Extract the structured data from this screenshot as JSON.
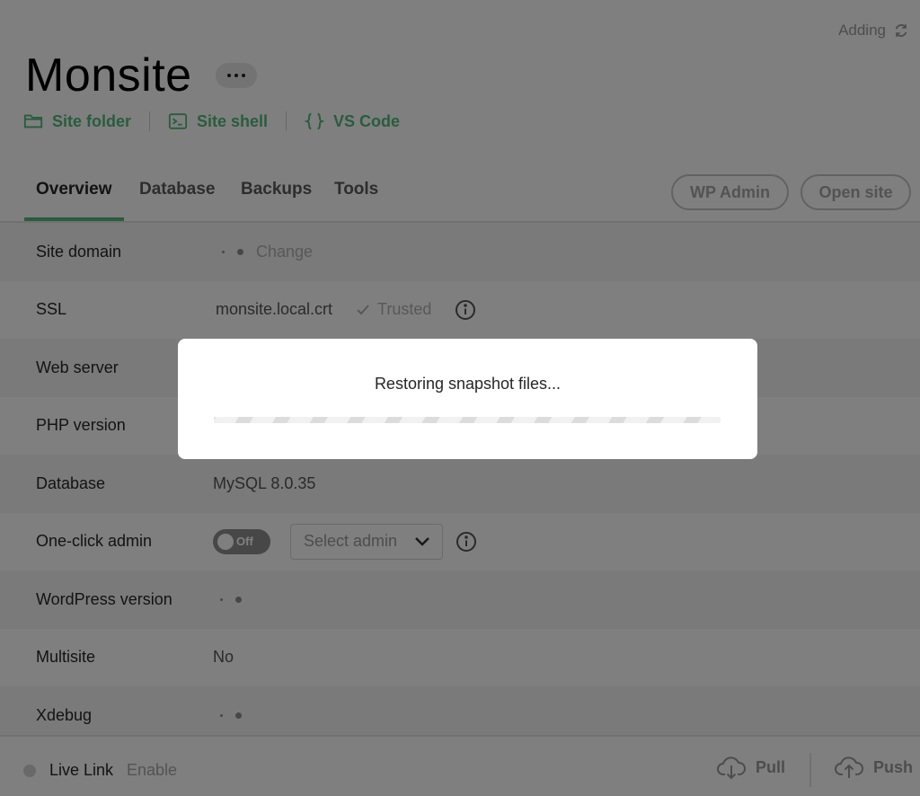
{
  "header": {
    "status": "Adding",
    "site_name": "Monsite",
    "quick_links": [
      {
        "label": "Site folder",
        "icon": "folder-icon"
      },
      {
        "label": "Site shell",
        "icon": "terminal-icon"
      },
      {
        "label": "VS Code",
        "icon": "braces-icon"
      }
    ]
  },
  "tabs": {
    "items": [
      "Overview",
      "Database",
      "Backups",
      "Tools"
    ],
    "active": "Overview",
    "wp_admin": "WP Admin",
    "open_site": "Open site"
  },
  "rows": {
    "site_domain": {
      "label": "Site domain",
      "action": "Change"
    },
    "ssl": {
      "label": "SSL",
      "value": "monsite.local.crt",
      "status": "Trusted"
    },
    "web_server": {
      "label": "Web server"
    },
    "php_version": {
      "label": "PHP version"
    },
    "database": {
      "label": "Database",
      "value": "MySQL 8.0.35"
    },
    "one_click_admin": {
      "label": "One-click admin",
      "toggle": "Off",
      "select_placeholder": "Select admin"
    },
    "wordpress_version": {
      "label": "WordPress version"
    },
    "multisite": {
      "label": "Multisite",
      "value": "No"
    },
    "xdebug": {
      "label": "Xdebug"
    }
  },
  "footer": {
    "live_link": "Live Link",
    "enable": "Enable",
    "pull": "Pull",
    "push": "Push"
  },
  "modal": {
    "message": "Restoring snapshot files..."
  },
  "colors": {
    "accent": "#51bb7b",
    "overlay": "rgba(0,0,0,0.5)"
  }
}
